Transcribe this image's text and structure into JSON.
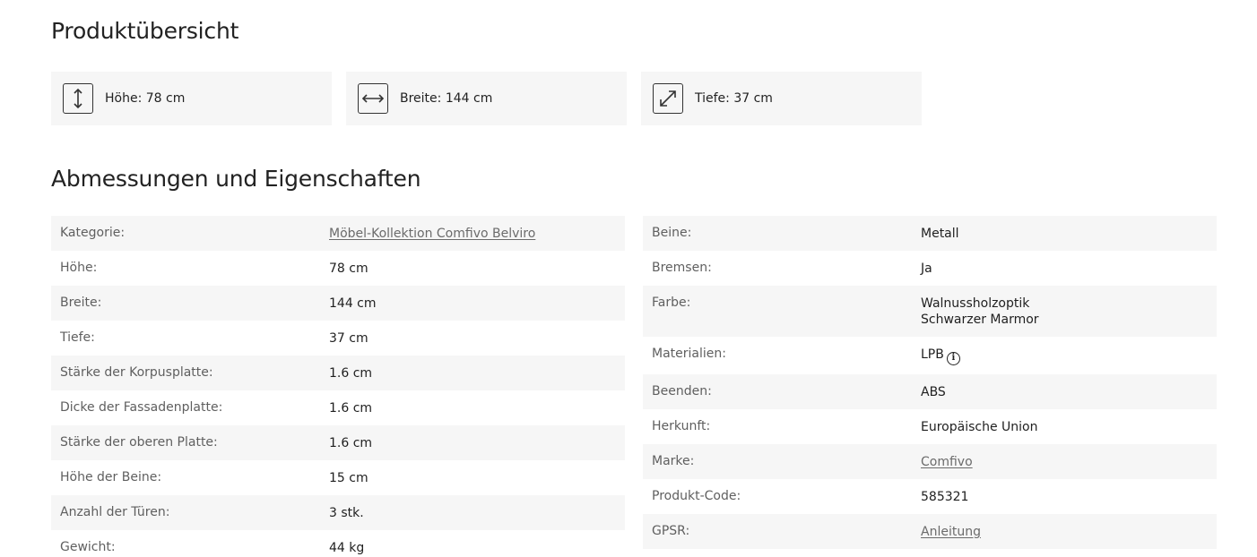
{
  "overview": {
    "title": "Produktübersicht",
    "cards": [
      {
        "icon": "vertical-arrow-icon",
        "label": "Höhe: 78 cm"
      },
      {
        "icon": "horizontal-arrow-icon",
        "label": "Breite: 144 cm"
      },
      {
        "icon": "diagonal-arrow-icon",
        "label": "Tiefe: 37 cm"
      }
    ]
  },
  "specs": {
    "title": "Abmessungen und Eigenschaften",
    "left": [
      {
        "key": "Kategorie:",
        "value": "Möbel-Kollektion Comfivo Belviro",
        "link": true
      },
      {
        "key": "Höhe:",
        "value": "78 cm"
      },
      {
        "key": "Breite:",
        "value": "144 cm"
      },
      {
        "key": "Tiefe:",
        "value": "37 cm"
      },
      {
        "key": "Stärke der Korpusplatte:",
        "value": "1.6 cm"
      },
      {
        "key": "Dicke der Fassadenplatte:",
        "value": "1.6 cm"
      },
      {
        "key": "Stärke der oberen Platte:",
        "value": "1.6 cm"
      },
      {
        "key": "Höhe der Beine:",
        "value": "15 cm"
      },
      {
        "key": "Anzahl der Türen:",
        "value": "3 stk."
      },
      {
        "key": "Gewicht:",
        "value": "44 kg"
      }
    ],
    "right": [
      {
        "key": "Beine:",
        "value": "Metall"
      },
      {
        "key": "Bremsen:",
        "value": "Ja"
      },
      {
        "key": "Farbe:",
        "value": "Walnussholzoptik",
        "value2": "Schwarzer Marmor"
      },
      {
        "key": "Materialien:",
        "value": "LPB",
        "info": true
      },
      {
        "key": "Beenden:",
        "value": "ABS"
      },
      {
        "key": "Herkunft:",
        "value": "Europäische Union"
      },
      {
        "key": "Marke:",
        "value": "Comfivo",
        "link": true
      },
      {
        "key": "Produkt-Code:",
        "value": "585321"
      },
      {
        "key": "GPSR:",
        "value": "Anleitung",
        "link": true
      }
    ]
  }
}
